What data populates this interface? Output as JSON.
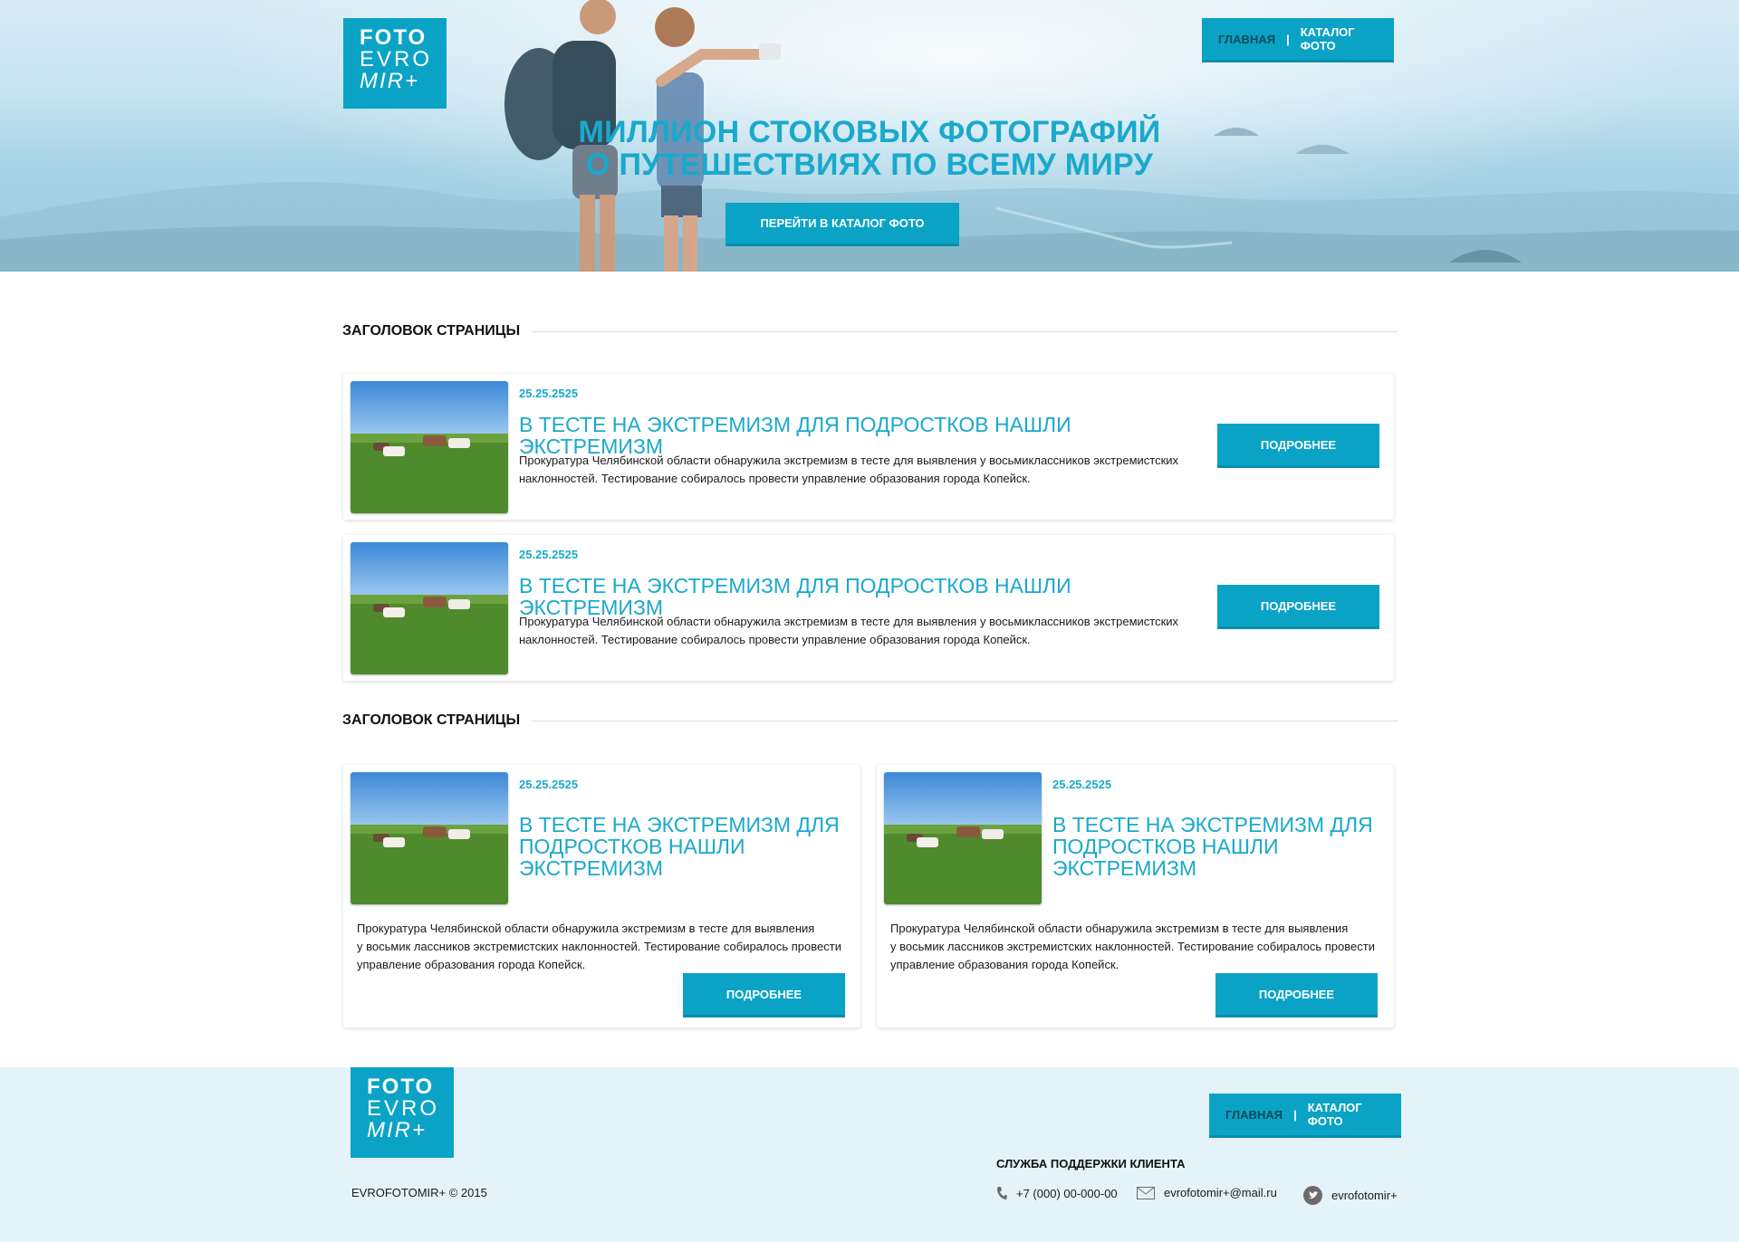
{
  "header": {
    "logo": {
      "line1": "FOTO",
      "line2": "EVRO",
      "line3": "MIR+"
    },
    "nav": {
      "home": "ГЛАВНАЯ",
      "separator": "|",
      "catalog": "КАТАЛОГ ФОТО"
    },
    "hero_title_line1": "МИЛЛИОН СТОКОВЫХ ФОТОГРАФИЙ",
    "hero_title_line2": "О ПУТЕШЕСТВИЯХ ПО ВСЕМУ МИРУ",
    "hero_button": "ПЕРЕЙТИ В КАТАЛОГ ФОТО"
  },
  "sections": [
    {
      "title": "ЗАГОЛОВОК СТРАНИЦЫ",
      "items": [
        {
          "date": "25.25.2525",
          "headline": "В ТЕСТЕ НА ЭКСТРЕМИЗМ ДЛЯ ПОДРОСТКОВ НАШЛИ ЭКСТРЕМИЗМ",
          "desc_line1": "Прокуратура Челябинской области обнаружила экстремизм в тесте для выявления у восьмиклассников экстремистских",
          "desc_line2": "наклонностей. Тестирование собиралось провести управление образования города Копейск.",
          "button": "ПОДРОБНЕЕ"
        },
        {
          "date": "25.25.2525",
          "headline": "В ТЕСТЕ НА ЭКСТРЕМИЗМ ДЛЯ ПОДРОСТКОВ НАШЛИ ЭКСТРЕМИЗМ",
          "desc_line1": "Прокуратура Челябинской области обнаружила экстремизм в тесте для выявления у восьмиклассников экстремистских",
          "desc_line2": "наклонностей. Тестирование собиралось провести управление образования города Копейск.",
          "button": "ПОДРОБНЕЕ"
        }
      ]
    },
    {
      "title": "ЗАГОЛОВОК СТРАНИЦЫ",
      "items": [
        {
          "date": "25.25.2525",
          "headline_line1": "В ТЕСТЕ НА ЭКСТРЕМИЗМ ДЛЯ",
          "headline_line2": "ПОДРОСТКОВ НАШЛИ",
          "headline_line3": "ЭКСТРЕМИЗМ",
          "desc_line1": "Прокуратура Челябинской области обнаружила экстремизм в тесте для выявления",
          "desc_line2": "у восьмик лассников экстремистских наклонностей. Тестирование собиралось провести",
          "desc_line3": "управление образования города Копейск.",
          "button": "ПОДРОБНЕЕ"
        },
        {
          "date": "25.25.2525",
          "headline_line1": "В ТЕСТЕ НА ЭКСТРЕМИЗМ ДЛЯ",
          "headline_line2": "ПОДРОСТКОВ НАШЛИ",
          "headline_line3": "ЭКСТРЕМИЗМ",
          "desc_line1": "Прокуратура Челябинской области обнаружила экстремизм в тесте для выявления",
          "desc_line2": "у восьмик лассников экстремистских наклонностей. Тестирование собиралось провести",
          "desc_line3": "управление образования города Копейск.",
          "button": "ПОДРОБНЕЕ"
        }
      ]
    }
  ],
  "footer": {
    "logo": {
      "line1": "FOTO",
      "line2": "EVRO",
      "line3": "MIR+"
    },
    "nav": {
      "home": "ГЛАВНАЯ",
      "separator": "|",
      "catalog": "КАТАЛОГ ФОТО"
    },
    "copyright": "EVROFOTOMIR+ © 2015",
    "support_title": "СЛУЖБА ПОДДЕРЖКИ КЛИЕНТА",
    "phone": "+7 (000) 00-000-00",
    "email": "evrofotomir+@mail.ru",
    "twitter": "evrofotomir+",
    "icons": {
      "phone": "phone-icon",
      "email": "mail-icon",
      "twitter": "twitter-icon"
    }
  },
  "colors": {
    "accent": "#0aa3c6",
    "accent_dark": "#088fae",
    "title_blue": "#19a9cc",
    "footer_bg": "#e3f3f9"
  }
}
